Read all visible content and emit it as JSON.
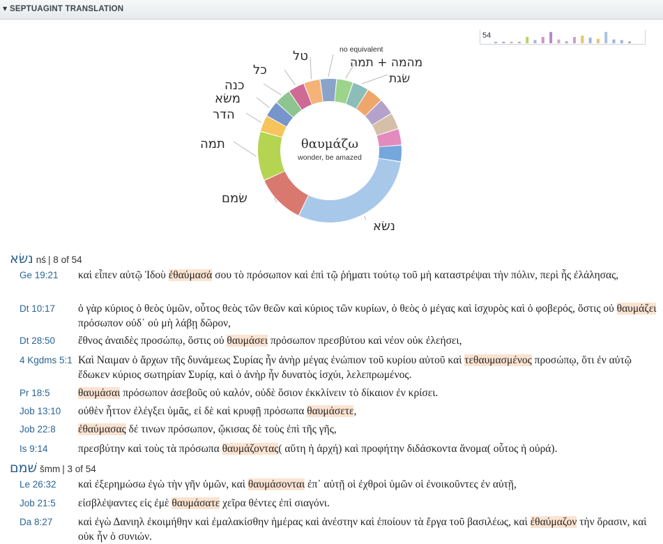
{
  "panel": {
    "title": "SEPTUAGINT TRANSLATION",
    "toggle_icon": "triangle-down-icon"
  },
  "histogram": {
    "count_label": "54",
    "bars": [
      {
        "v": 0.12,
        "c": "#9fb5d6"
      },
      {
        "v": 0.12,
        "c": "#b5a5c9"
      },
      {
        "v": 0.12,
        "c": "#c9b98d"
      },
      {
        "v": 0.12,
        "c": "#9fb5d6"
      },
      {
        "v": 0.5,
        "c": "#b5d36a"
      },
      {
        "v": 0.25,
        "c": "#9fb5d6"
      },
      {
        "v": 0.5,
        "c": "#c79ac0"
      },
      {
        "v": 0.9,
        "c": "#b989c9"
      },
      {
        "v": 0.3,
        "c": "#d9a6c4"
      },
      {
        "v": 0.15,
        "c": "#b5a5c9"
      },
      {
        "v": 0.5,
        "c": "#c4a5cf"
      },
      {
        "v": 0.6,
        "c": "#e8c46a"
      },
      {
        "v": 0.45,
        "c": "#9fb5d6"
      },
      {
        "v": 0.35,
        "c": "#e8c46a"
      },
      {
        "v": 0.9,
        "c": "#a9c2dd"
      },
      {
        "v": 0.3,
        "c": "#9fb5d6"
      },
      {
        "v": 0.25,
        "c": "#9fb5d6"
      },
      {
        "v": 0.15,
        "c": "#b5a5c9"
      }
    ]
  },
  "chart_data": {
    "type": "pie",
    "center_title": "θαυμάζω",
    "center_subtitle": "wonder, be amazed",
    "slices": [
      {
        "label": "נשׂא",
        "value": 8,
        "color": "#a8c8ea"
      },
      {
        "label": "שׂמם",
        "value": 3,
        "color": "#d9786f"
      },
      {
        "label": "תמה",
        "value": 3,
        "color": "#b5d452"
      },
      {
        "label": "הדר",
        "value": 1,
        "color": "#f5c45a"
      },
      {
        "label": "משׂא",
        "value": 1,
        "color": "#7795cb"
      },
      {
        "label": "כנה",
        "value": 1,
        "color": "#8ec48f"
      },
      {
        "label": "כל",
        "value": 1,
        "color": "#cf6a95"
      },
      {
        "label": "טל",
        "value": 1,
        "color": "#f5b377"
      },
      {
        "label": "no equivalent",
        "value": 1,
        "color": "#8aa3c9"
      },
      {
        "label": "מהמה + תמה",
        "value": 1,
        "color": "#9bd48a"
      },
      {
        "label": "שׂגת",
        "value": 1,
        "color": "#8cbdb8"
      },
      {
        "label": "",
        "value": 1,
        "color": "#eea66a"
      },
      {
        "label": "",
        "value": 1,
        "color": "#b4a2cb"
      },
      {
        "label": "",
        "value": 1,
        "color": "#d6bfa8"
      },
      {
        "label": "",
        "value": 1,
        "color": "#e38bbf"
      },
      {
        "label": "",
        "value": 1,
        "color": "#74a7dc"
      }
    ]
  },
  "groups": [
    {
      "headword": "נשׂא",
      "translit": "nś",
      "count": "| 8 of 54",
      "verses": [
        {
          "ref": "Ge 19:21",
          "pre": "καὶ εἶπεν αὐτῷ Ἰδοὺ ",
          "hl": "ἐθαύμασά",
          "post": " σου τὸ πρόσωπον καὶ ἐπὶ τῷ ῥήματι τούτῳ τοῦ μὴ καταστρέψαι τὴν πόλιν, περὶ ἧς ἐλάλησας,"
        },
        {
          "ref": "Dt 10:17",
          "pre": "ὁ γὰρ κύριος ὁ θεὸς ὑμῶν, οὗτος θεὸς τῶν θεῶν καὶ κύριος τῶν κυρίων, ὁ θεὸς ὁ μέγας καὶ ἰσχυρὸς καὶ ὁ φοβερός, ὅστις οὐ ",
          "hl": "θαυμάζει",
          "post": " πρόσωπον οὐδ᾽ οὐ μὴ λάβῃ δῶρον,"
        },
        {
          "ref": "Dt 28:50",
          "pre": "ἔθνος ἀναιδὲς προσώπῳ, ὅστις οὐ ",
          "hl": "θαυμάσει",
          "post": " πρόσωπον πρεσβύτου καὶ νέον οὐκ ἐλεήσει,"
        },
        {
          "ref": "4 Kgdms 5:1",
          "pre": "Καὶ Ναιμαν ὁ ἄρχων τῆς δυνάμεως Συρίας ἦν ἀνὴρ μέγας ἐνώπιον τοῦ κυρίου αὐτοῦ καὶ ",
          "hl": "τεθαυμασμένος",
          "post": " προσώπῳ, ὅτι ἐν αὐτῷ ἔδωκεν κύριος σωτηρίαν Συρίᾳ, καὶ ὁ ἀνὴρ ἦν δυνατὸς ἰσχύι, λελεπρωμένος."
        },
        {
          "ref": "Pr 18:5",
          "pre": "",
          "hl": "θαυμάσαι",
          "post": " πρόσωπον ἀσεβοῦς οὐ καλόν, οὐδὲ ὅσιον ἐκκλίνειν τὸ δίκαιον ἐν κρίσει."
        },
        {
          "ref": "Job 13:10",
          "pre": "οὐθὲν ἧττον ἐλέγξει ὑμᾶς, εἰ δὲ καὶ κρυφῇ πρόσωπα ",
          "hl": "θαυμάσετε",
          "post": ","
        },
        {
          "ref": "Job 22:8",
          "pre": "",
          "hl": "ἐθαύμασας",
          "post": " δέ τινων πρόσωπον, ᾤκισας δὲ τοὺς ἐπὶ τῆς γῆς,"
        },
        {
          "ref": "Is 9:14",
          "pre": "πρεσβύτην καὶ τοὺς τὰ πρόσωπα ",
          "hl": "θαυμάζοντας",
          "post": "( αὕτη ἡ ἀρχή) καὶ προφήτην διδάσκοντα ἄνομα( οὗτος ἡ οὐρά)."
        }
      ]
    },
    {
      "headword": "שׁמם",
      "translit": "šmm",
      "count": "| 3 of 54",
      "verses": [
        {
          "ref": "Le 26:32",
          "pre": "καὶ ἐξερημώσω ἐγὼ τὴν γῆν ὑμῶν, καὶ ",
          "hl": "θαυμάσονται",
          "post": " ἐπ᾽ αὐτῇ οἱ ἐχθροὶ ὑμῶν οἱ ἐνοικοῦντες ἐν αὐτῇ,"
        },
        {
          "ref": "Job 21:5",
          "pre": "εἰσβλέψαντες εἰς ἐμὲ ",
          "hl": "θαυμάσατε",
          "post": " χεῖρα θέντες ἐπὶ σιαγόνι."
        },
        {
          "ref": "Da 8:27",
          "pre": "καὶ ἐγὼ Δανιηλ ἐκοιμήθην καὶ ἐμαλακίσθην ἡμέρας καὶ ἀνέστην καὶ ἐποίουν τὰ ἔργα τοῦ βασιλέως, καὶ ",
          "hl": "ἐθαύμαζον",
          "post": " τὴν ὅρασιν, καὶ οὐκ ἦν ὁ συνιών."
        }
      ]
    }
  ]
}
